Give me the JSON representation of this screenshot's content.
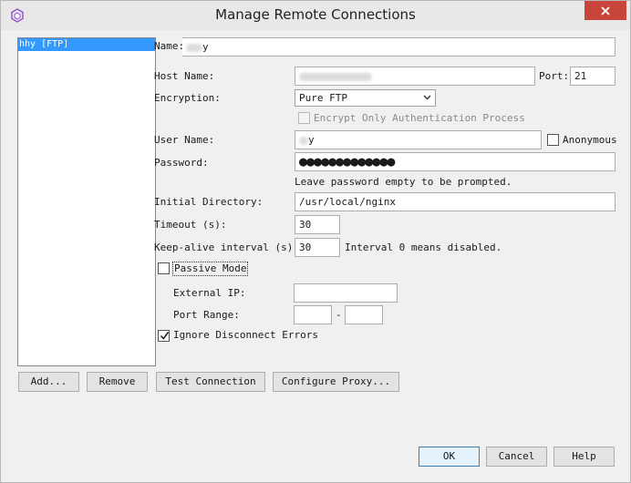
{
  "window": {
    "title": "Manage Remote Connections"
  },
  "colors": {
    "selection": "#3399ff",
    "close_button": "#c7453a",
    "default_button_border": "#3c7fb1"
  },
  "connections": {
    "items": [
      {
        "label": "hhy [FTP]"
      }
    ]
  },
  "form": {
    "name_label": "Name:",
    "name_value_suffix": "y",
    "host_label": "Host Name:",
    "port_label": "Port:",
    "port_value": "21",
    "encryption_label": "Encryption:",
    "encryption_value": "Pure FTP",
    "encrypt_only_label": "Encrypt Only Authentication Process",
    "encrypt_only_checked": false,
    "user_label": "User Name:",
    "user_value_suffix": "y",
    "anonymous_label": "Anonymous",
    "anonymous_checked": false,
    "password_label": "Password:",
    "password_value": "●●●●●●●●●●●●●",
    "password_hint": "Leave password empty to be prompted.",
    "initial_dir_label": "Initial Directory:",
    "initial_dir_value": "/usr/local/nginx",
    "timeout_label": "Timeout (s):",
    "timeout_value": "30",
    "keepalive_label": "Keep-alive interval (s):",
    "keepalive_value": "30",
    "keepalive_hint": "Interval 0 means disabled.",
    "passive_label": "Passive Mode",
    "passive_checked": false,
    "external_ip_label": "External IP:",
    "external_ip_value": "",
    "port_range_label": "Port Range:",
    "port_range_dash": "-",
    "port_range_from": "",
    "port_range_to": "",
    "ignore_errors_label": "Ignore Disconnect Errors",
    "ignore_errors_checked": true
  },
  "buttons": {
    "add": "Add...",
    "remove": "Remove",
    "test": "Test Connection",
    "proxy": "Configure Proxy...",
    "ok": "OK",
    "cancel": "Cancel",
    "help": "Help"
  }
}
